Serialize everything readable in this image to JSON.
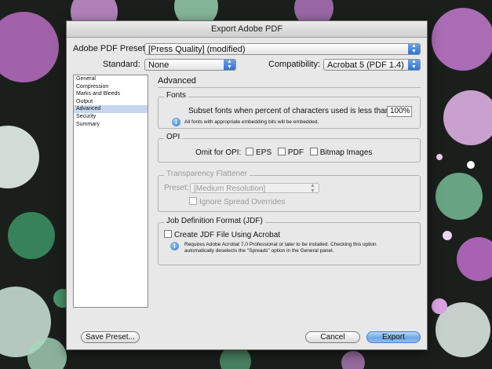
{
  "window": {
    "title": "Export Adobe PDF"
  },
  "header": {
    "preset_label": "Adobe PDF Preset:",
    "preset_value": "[Press Quality] (modified)",
    "standard_label": "Standard:",
    "standard_value": "None",
    "compat_label": "Compatibility:",
    "compat_value": "Acrobat 5 (PDF 1.4)"
  },
  "sidebar": {
    "items": [
      {
        "label": "General",
        "selected": false
      },
      {
        "label": "Compression",
        "selected": false
      },
      {
        "label": "Marks and Bleeds",
        "selected": false
      },
      {
        "label": "Output",
        "selected": false
      },
      {
        "label": "Advanced",
        "selected": true
      },
      {
        "label": "Security",
        "selected": false
      },
      {
        "label": "Summary",
        "selected": false
      }
    ]
  },
  "main": {
    "section_title": "Advanced",
    "fonts": {
      "title": "Fonts",
      "subset_label": "Subset fonts when percent of characters used is less than:",
      "subset_value": "100%",
      "note": "All fonts with appropriate embedding bits will be embedded."
    },
    "opi": {
      "title": "OPI",
      "omit_label": "Omit for OPI:",
      "eps": "EPS",
      "pdf": "PDF",
      "bitmap": "Bitmap Images"
    },
    "transparency": {
      "title": "Transparency Flattener",
      "preset_label": "Preset:",
      "preset_value": "[Medium Resolution]",
      "ignore_label": "Ignore Spread Overrides"
    },
    "jdf": {
      "title": "Job Definition Format (JDF)",
      "create_label": "Create JDF File Using Acrobat",
      "note_line1": "Requires Adobe Acrobat 7.0 Professional or later to be installed. Checking this option",
      "note_line2": "automatically deselects the \"Spreads\" option in the General panel."
    }
  },
  "footer": {
    "save_preset": "Save Preset...",
    "cancel": "Cancel",
    "export": "Export"
  }
}
